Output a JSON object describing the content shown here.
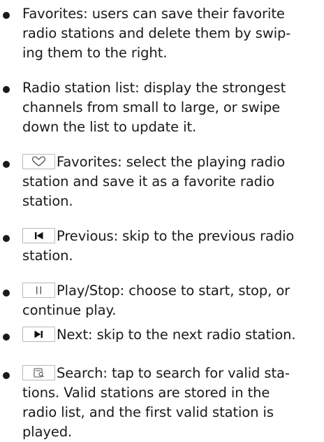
{
  "items": [
    {
      "lines": [
        "Favorites: users can save their favorite",
        "radio stations and delete them by swip-",
        "ing them to the right."
      ]
    },
    {
      "lines": [
        "Radio station list: display the strongest",
        "channels from small to large, or swipe",
        "down the list to update it."
      ]
    },
    {
      "icon": "heart-icon",
      "lines": [
        "Favorites: select the playing radio",
        "station and save it as a favorite radio",
        "station."
      ]
    },
    {
      "icon": "previous-icon",
      "lines": [
        "Previous: skip to the previous radio",
        "station."
      ]
    },
    {
      "icon": "pause-icon",
      "lines": [
        "Play/Stop: choose to start, stop, or",
        "continue play."
      ]
    },
    {
      "icon": "next-icon",
      "lines": [
        "Next: skip to the next radio station."
      ]
    },
    {
      "icon": "search-icon",
      "lines": [
        "Search: tap to search for valid sta-",
        "tions. Valid stations are stored in the",
        "radio list, and the first valid station is",
        "played."
      ]
    }
  ]
}
